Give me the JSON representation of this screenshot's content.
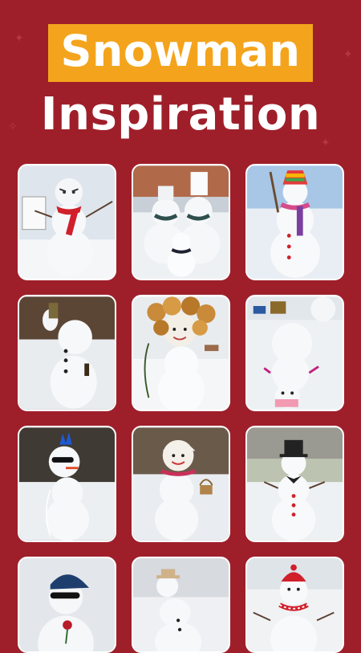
{
  "header": {
    "title_line1": "Snowman",
    "title_line2": "Inspiration"
  },
  "colors": {
    "background": "#9e1f2a",
    "title_highlight": "#f4a41c",
    "title_text": "#ffffff"
  },
  "gallery": {
    "items": [
      {
        "icon": "snowman-angry-red-scarf"
      },
      {
        "icon": "snowman-family"
      },
      {
        "icon": "snowman-colorful-hat"
      },
      {
        "icon": "snowman-drinking"
      },
      {
        "icon": "snowman-leaf-hair"
      },
      {
        "icon": "snowman-upside-down"
      },
      {
        "icon": "snowman-mohawk-sunglasses"
      },
      {
        "icon": "snowman-with-basket"
      },
      {
        "icon": "snowman-top-hat"
      },
      {
        "icon": "snowman-baseball-cap"
      },
      {
        "icon": "snowman-straw-hat"
      },
      {
        "icon": "snowman-red-hat-scarf"
      }
    ]
  }
}
